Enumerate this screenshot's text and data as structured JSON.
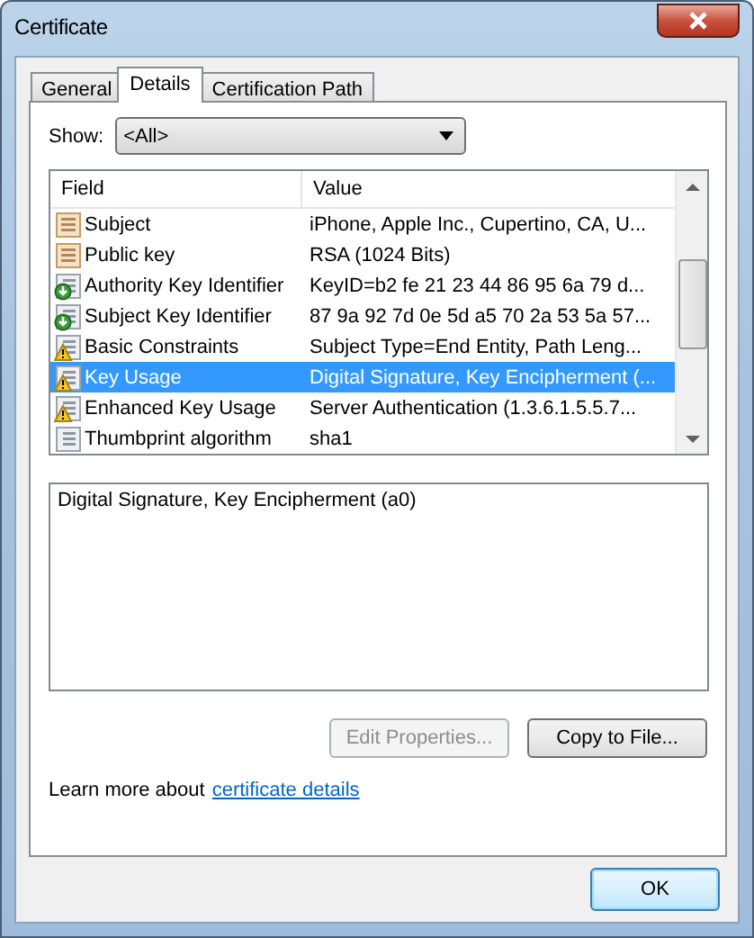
{
  "window": {
    "title": "Certificate"
  },
  "tabs": [
    {
      "label": "General",
      "selected": false
    },
    {
      "label": "Details",
      "selected": true
    },
    {
      "label": "Certification Path",
      "selected": false
    }
  ],
  "show": {
    "label": "Show:",
    "value": "<All>"
  },
  "fields_table": {
    "columns": [
      "Field",
      "Value"
    ],
    "rows": [
      {
        "kind": "cert",
        "field": "Subject",
        "value": "iPhone, Apple Inc., Cupertino, CA, U...",
        "selected": false
      },
      {
        "kind": "cert",
        "field": "Public key",
        "value": "RSA (1024 Bits)",
        "selected": false
      },
      {
        "kind": "down",
        "field": "Authority Key Identifier",
        "value": "KeyID=b2 fe 21 23 44 86 95 6a 79 d...",
        "selected": false
      },
      {
        "kind": "down",
        "field": "Subject Key Identifier",
        "value": "87 9a 92 7d 0e 5d a5 70 2a 53 5a 57...",
        "selected": false
      },
      {
        "kind": "warn",
        "field": "Basic Constraints",
        "value": "Subject Type=End Entity, Path Leng...",
        "selected": false
      },
      {
        "kind": "warn",
        "field": "Key Usage",
        "value": "Digital Signature, Key Encipherment (...",
        "selected": true
      },
      {
        "kind": "warn",
        "field": "Enhanced Key Usage",
        "value": "Server Authentication (1.3.6.1.5.5.7...",
        "selected": false
      },
      {
        "kind": "plain",
        "field": "Thumbprint algorithm",
        "value": "sha1",
        "selected": false
      }
    ]
  },
  "detail_text": "Digital Signature, Key Encipherment (a0)",
  "buttons": [
    {
      "label": "Edit Properties...",
      "disabled": true
    },
    {
      "label": "Copy to File...",
      "disabled": false
    }
  ],
  "learn_more": {
    "text": "Learn more about",
    "link": "certificate details"
  },
  "ok_button": "OK"
}
